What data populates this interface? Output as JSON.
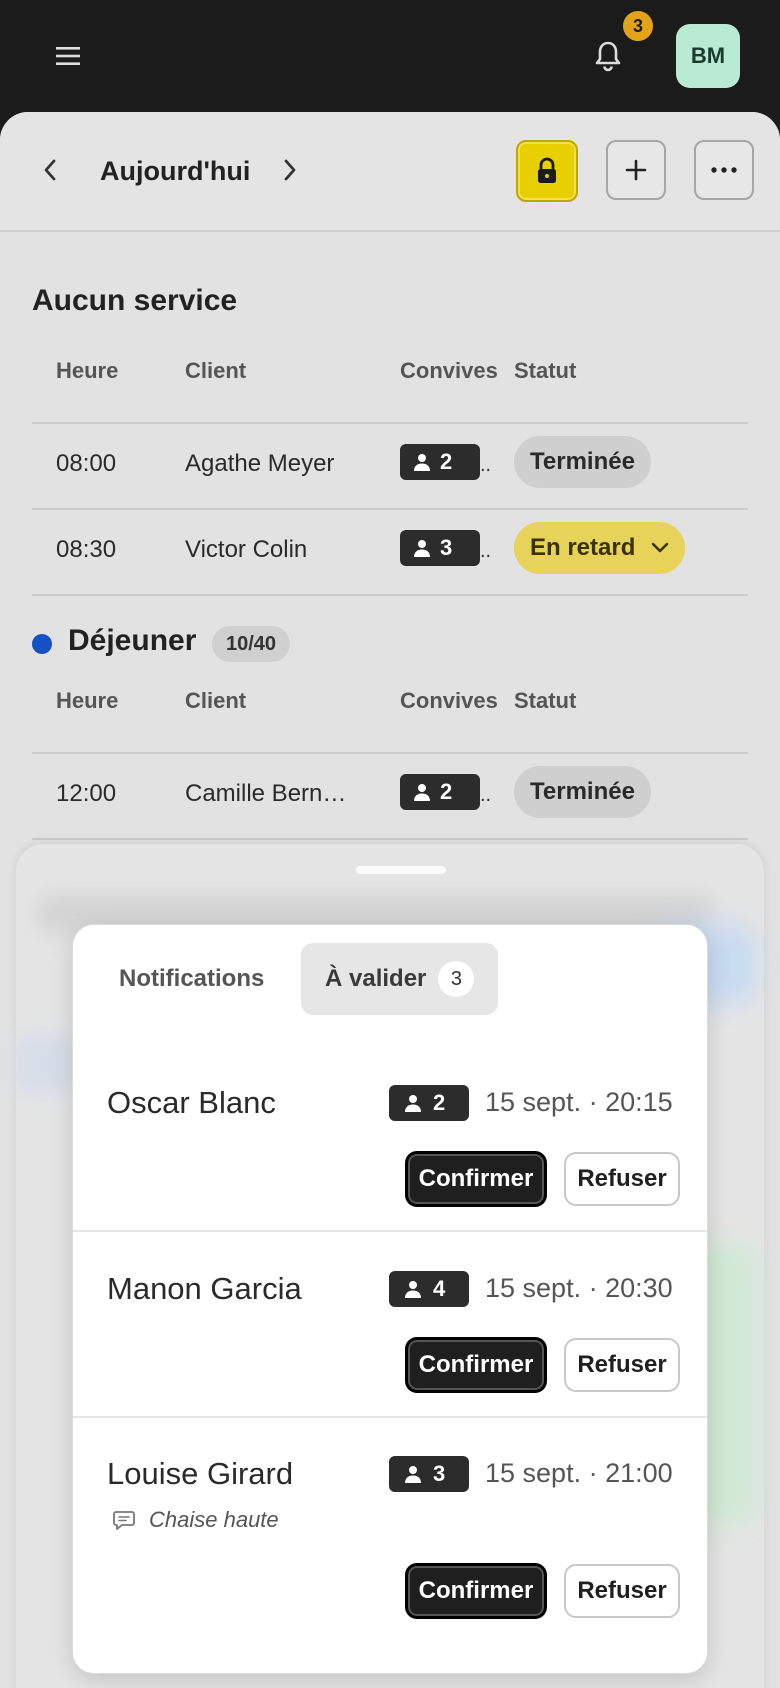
{
  "header": {
    "notification_count": "3",
    "avatar_initials": "BM"
  },
  "nav": {
    "title": "Aujourd'hui"
  },
  "table_headers": {
    "time": "Heure",
    "client": "Client",
    "guests": "Convives",
    "status": "Statut"
  },
  "sections": [
    {
      "title": "Aucun service",
      "rows": [
        {
          "time": "08:00",
          "client": "Agathe Meyer",
          "guests": "2",
          "status": "Terminée"
        },
        {
          "time": "08:30",
          "client": "Victor Colin",
          "guests": "3",
          "status": "En retard"
        }
      ]
    },
    {
      "title": "Déjeuner",
      "capacity": "10/40",
      "dot_color": "#1650c6",
      "rows": [
        {
          "time": "12:00",
          "client": "Camille Bern…",
          "guests": "2",
          "status": "Terminée"
        }
      ]
    }
  ],
  "panel": {
    "tabs": [
      {
        "label": "Notifications"
      },
      {
        "label": "À valider",
        "count": "3"
      }
    ],
    "requests": [
      {
        "name": "Oscar Blanc",
        "guests": "2",
        "date": "15 sept. · 20:15",
        "confirm": "Confirmer",
        "refuse": "Refuser"
      },
      {
        "name": "Manon Garcia",
        "guests": "4",
        "date": "15 sept. · 20:30",
        "confirm": "Confirmer",
        "refuse": "Refuser"
      },
      {
        "name": "Louise Girard",
        "guests": "3",
        "date": "15 sept. · 21:00",
        "note": "Chaise haute",
        "confirm": "Confirmer",
        "refuse": "Refuser"
      }
    ]
  },
  "colors": {
    "accent_lock": "#e8cf00",
    "late_status": "#e7d25a",
    "avatar_bg": "#b9ead3",
    "badge": "#e2a21a"
  }
}
